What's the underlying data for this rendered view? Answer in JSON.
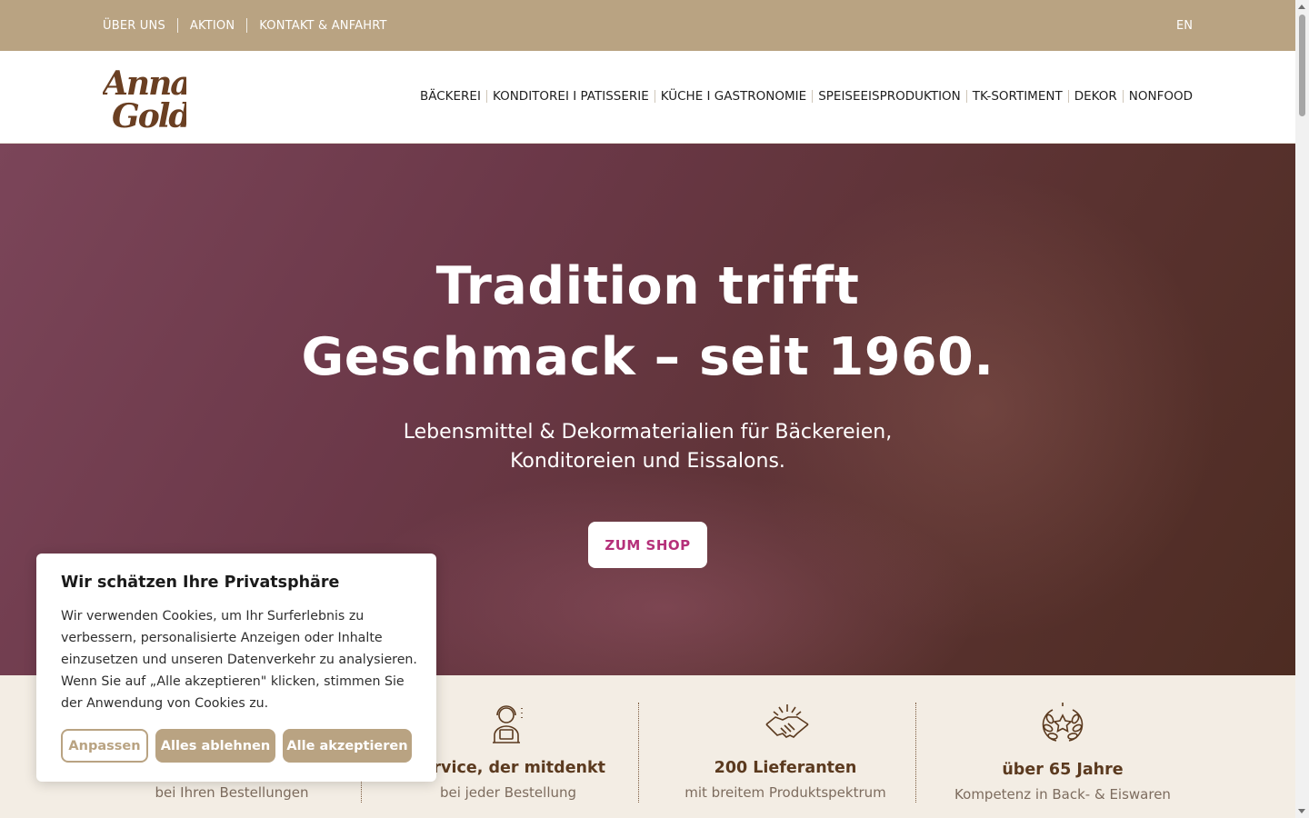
{
  "topbar": {
    "links": [
      "ÜBER UNS",
      "AKTION",
      "KONTAKT & ANFAHRT"
    ],
    "lang": "EN"
  },
  "logo": {
    "line1": "Anna",
    "line2": "Gold"
  },
  "nav": [
    "BÄCKEREI",
    "KONDITOREI I PATISSERIE",
    "KÜCHE I GASTRONOMIE",
    "SPEISEEISPRODUKTION",
    "TK-SORTIMENT",
    "DEKOR",
    "NONFOOD"
  ],
  "hero": {
    "title_line1": "Tradition trifft",
    "title_line2": "Geschmack – seit 1960.",
    "sub_line1": "Lebensmittel & Dekormaterialien für Bäckereien,",
    "sub_line2": "Konditoreien und Eissalons.",
    "cta": "ZUM SHOP"
  },
  "features": [
    {
      "icon": "cart-icon",
      "title": "",
      "subtitle": "bei Ihren Bestellungen"
    },
    {
      "icon": "support-agent-icon",
      "title": "Service, der mitdenkt",
      "subtitle": "bei jeder Bestellung"
    },
    {
      "icon": "handshake-icon",
      "title": "200 Lieferanten",
      "subtitle": "mit breitem Produktspektrum"
    },
    {
      "icon": "laurel-star-icon",
      "title": "über 65 Jahre",
      "subtitle": "Kompetenz in Back- & Eiswaren"
    }
  ],
  "cookie": {
    "title": "Wir schätzen Ihre Privatsphäre",
    "text": "Wir verwenden Cookies, um Ihr Surferlebnis zu verbessern, personalisierte Anzeigen oder Inhalte einzusetzen und unseren Datenverkehr zu analysieren. Wenn Sie auf „Alle akzeptieren\" klicken, stimmen Sie der Anwendung von Cookies zu.",
    "btn_customize": "Anpassen",
    "btn_reject": "Alles ablehnen",
    "btn_accept": "Alle akzeptieren"
  },
  "colors": {
    "brand_gold": "#b9a382",
    "brand_brown": "#5b3a1f",
    "cta_magenta": "#b5307a",
    "feature_bg": "#f3ede4"
  }
}
